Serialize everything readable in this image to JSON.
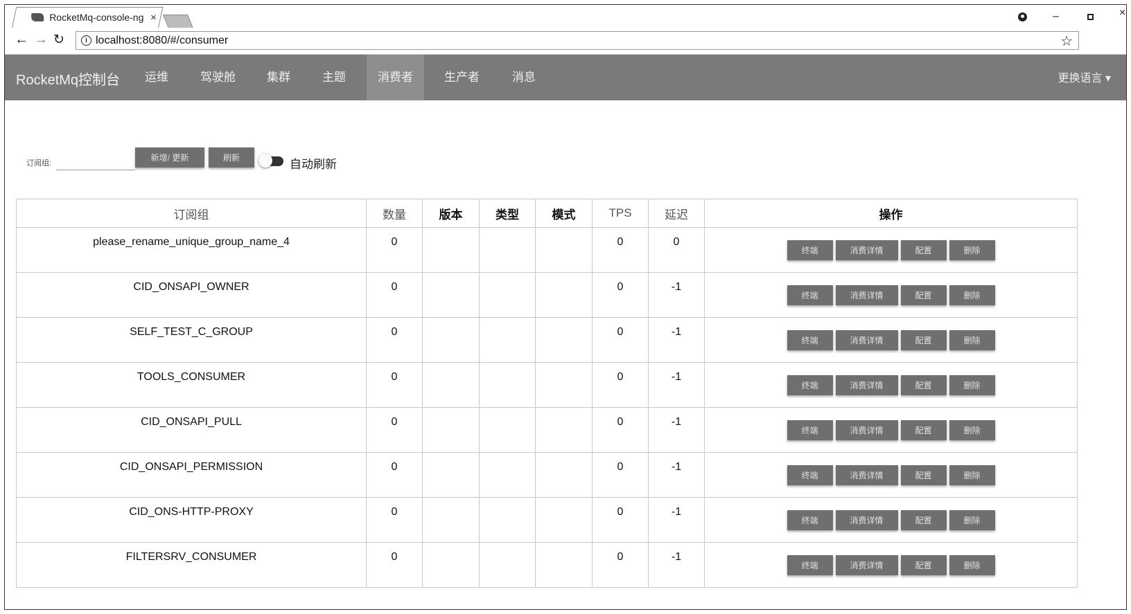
{
  "browser": {
    "tab_title": "RocketMq-console-ng",
    "tab_close": "×",
    "url": "localhost:8080/#/consumer",
    "minimize": "–",
    "close": "×"
  },
  "app": {
    "brand": "RocketMq控制台",
    "nav": [
      "运维",
      "驾驶舱",
      "集群",
      "主题",
      "消费者",
      "生产者",
      "消息"
    ],
    "active_nav": "消费者",
    "language": "更换语言 ▾"
  },
  "filter": {
    "label": "订阅组:",
    "value": "",
    "add_update_label": "新增/ 更新",
    "refresh_label": "刷新",
    "auto_refresh_label": "自动刷新",
    "auto_refresh_on": false
  },
  "table": {
    "columns": [
      "订阅组",
      "数量",
      "版本",
      "类型",
      "模式",
      "TPS",
      "延迟",
      "操作"
    ],
    "action_labels": [
      "终端",
      "消费详情",
      "配置",
      "删除"
    ],
    "rows": [
      {
        "group": "please_rename_unique_group_name_4",
        "count": "0",
        "version": "",
        "type": "",
        "mode": "",
        "tps": "0",
        "delay": "0"
      },
      {
        "group": "CID_ONSAPI_OWNER",
        "count": "0",
        "version": "",
        "type": "",
        "mode": "",
        "tps": "0",
        "delay": "-1"
      },
      {
        "group": "SELF_TEST_C_GROUP",
        "count": "0",
        "version": "",
        "type": "",
        "mode": "",
        "tps": "0",
        "delay": "-1"
      },
      {
        "group": "TOOLS_CONSUMER",
        "count": "0",
        "version": "",
        "type": "",
        "mode": "",
        "tps": "0",
        "delay": "-1"
      },
      {
        "group": "CID_ONSAPI_PULL",
        "count": "0",
        "version": "",
        "type": "",
        "mode": "",
        "tps": "0",
        "delay": "-1"
      },
      {
        "group": "CID_ONSAPI_PERMISSION",
        "count": "0",
        "version": "",
        "type": "",
        "mode": "",
        "tps": "0",
        "delay": "-1"
      },
      {
        "group": "CID_ONS-HTTP-PROXY",
        "count": "0",
        "version": "",
        "type": "",
        "mode": "",
        "tps": "0",
        "delay": "-1"
      },
      {
        "group": "FILTERSRV_CONSUMER",
        "count": "0",
        "version": "",
        "type": "",
        "mode": "",
        "tps": "0",
        "delay": "-1"
      }
    ]
  }
}
